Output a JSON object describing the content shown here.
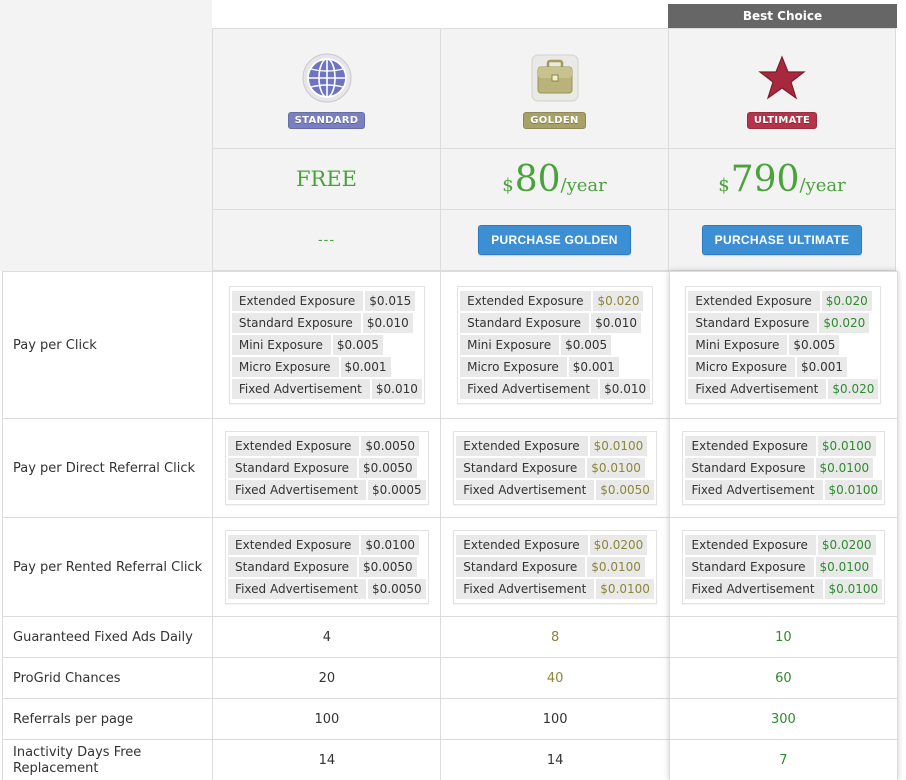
{
  "best_choice_label": "Best Choice",
  "plans": {
    "standard": {
      "badge": "STANDARD",
      "price_text": "FREE",
      "action_text": "---"
    },
    "golden": {
      "badge": "GOLDEN",
      "currency": "$",
      "amount": "80",
      "per": "/year",
      "button": "PURCHASE GOLDEN"
    },
    "ultimate": {
      "badge": "ULTIMATE",
      "currency": "$",
      "amount": "790",
      "per": "/year",
      "button": "PURCHASE ULTIMATE"
    }
  },
  "colors": {
    "standard": "#333333",
    "golden": "#8c8637",
    "ultimate": "#2e8b2e",
    "price": "#4aa33a",
    "button": "#3d8fd3"
  },
  "icons": {
    "standard": "globe-icon",
    "golden": "briefcase-icon",
    "ultimate": "star-icon"
  },
  "features": {
    "ppc": {
      "label": "Pay per Click",
      "standard": [
        [
          "Extended Exposure",
          "$0.015"
        ],
        [
          "Standard Exposure",
          "$0.010"
        ],
        [
          "Mini Exposure",
          "$0.005"
        ],
        [
          "Micro Exposure",
          "$0.001"
        ],
        [
          "Fixed Advertisement",
          "$0.010"
        ]
      ],
      "golden": [
        [
          "Extended Exposure",
          "$0.020"
        ],
        [
          "Standard Exposure",
          "$0.010"
        ],
        [
          "Mini Exposure",
          "$0.005"
        ],
        [
          "Micro Exposure",
          "$0.001"
        ],
        [
          "Fixed Advertisement",
          "$0.010"
        ]
      ],
      "ultimate": [
        [
          "Extended Exposure",
          "$0.020"
        ],
        [
          "Standard Exposure",
          "$0.020"
        ],
        [
          "Mini Exposure",
          "$0.005"
        ],
        [
          "Micro Exposure",
          "$0.001"
        ],
        [
          "Fixed Advertisement",
          "$0.020"
        ]
      ]
    },
    "direct": {
      "label": "Pay per Direct Referral Click",
      "standard": [
        [
          "Extended Exposure",
          "$0.0050"
        ],
        [
          "Standard Exposure",
          "$0.0050"
        ],
        [
          "Fixed Advertisement",
          "$0.0005"
        ]
      ],
      "golden": [
        [
          "Extended Exposure",
          "$0.0100"
        ],
        [
          "Standard Exposure",
          "$0.0100"
        ],
        [
          "Fixed Advertisement",
          "$0.0050"
        ]
      ],
      "ultimate": [
        [
          "Extended Exposure",
          "$0.0100"
        ],
        [
          "Standard Exposure",
          "$0.0100"
        ],
        [
          "Fixed Advertisement",
          "$0.0100"
        ]
      ]
    },
    "rented": {
      "label": "Pay per Rented Referral Click",
      "standard": [
        [
          "Extended Exposure",
          "$0.0100"
        ],
        [
          "Standard Exposure",
          "$0.0050"
        ],
        [
          "Fixed Advertisement",
          "$0.0050"
        ]
      ],
      "golden": [
        [
          "Extended Exposure",
          "$0.0200"
        ],
        [
          "Standard Exposure",
          "$0.0100"
        ],
        [
          "Fixed Advertisement",
          "$0.0100"
        ]
      ],
      "ultimate": [
        [
          "Extended Exposure",
          "$0.0200"
        ],
        [
          "Standard Exposure",
          "$0.0100"
        ],
        [
          "Fixed Advertisement",
          "$0.0100"
        ]
      ]
    },
    "fixed_ads": {
      "label": "Guaranteed Fixed Ads Daily",
      "standard": "4",
      "golden": "8",
      "ultimate": "10"
    },
    "progrid": {
      "label": "ProGrid Chances",
      "standard": "20",
      "golden": "40",
      "ultimate": "60"
    },
    "referrals": {
      "label": "Referrals per page",
      "standard": "100",
      "golden": "100",
      "ultimate": "300"
    },
    "inactivity": {
      "label": "Inactivity Days Free Replacement",
      "standard": "14",
      "golden": "14",
      "ultimate": "7"
    }
  },
  "highlight": {
    "golden": {
      "ppc": [
        true,
        false,
        false,
        false,
        false
      ],
      "direct": [
        true,
        true,
        true
      ],
      "rented": [
        true,
        true,
        true
      ]
    },
    "ultimate": {
      "ppc": [
        true,
        true,
        false,
        false,
        true
      ],
      "direct": [
        true,
        true,
        true
      ],
      "rented": [
        true,
        true,
        true
      ]
    }
  }
}
